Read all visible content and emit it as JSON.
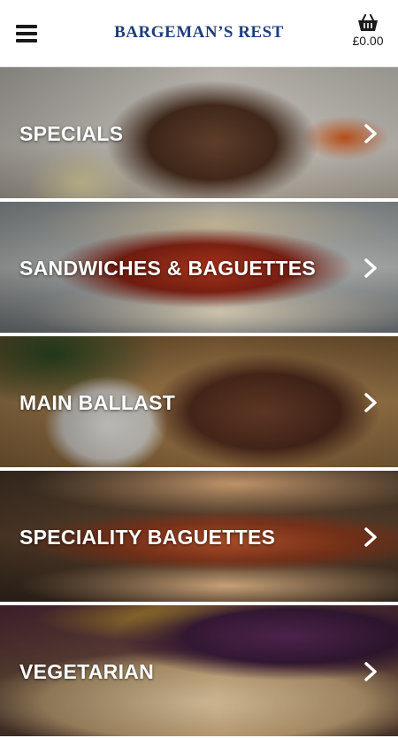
{
  "header": {
    "brand": "BARGEMAN’S REST",
    "basket_total": "£0.00",
    "menu_icon": "hamburger-menu-icon",
    "basket_icon": "shopping-basket-icon"
  },
  "categories": [
    {
      "label": "SPECIALS"
    },
    {
      "label": "SANDWICHES & BAGUETTES"
    },
    {
      "label": "MAIN BALLAST"
    },
    {
      "label": "SPECIALITY BAGUETTES"
    },
    {
      "label": "VEGETARIAN"
    }
  ],
  "colors": {
    "brand": "#1f3d7a",
    "header_bg": "#ffffff",
    "label_text": "#ffffff"
  }
}
